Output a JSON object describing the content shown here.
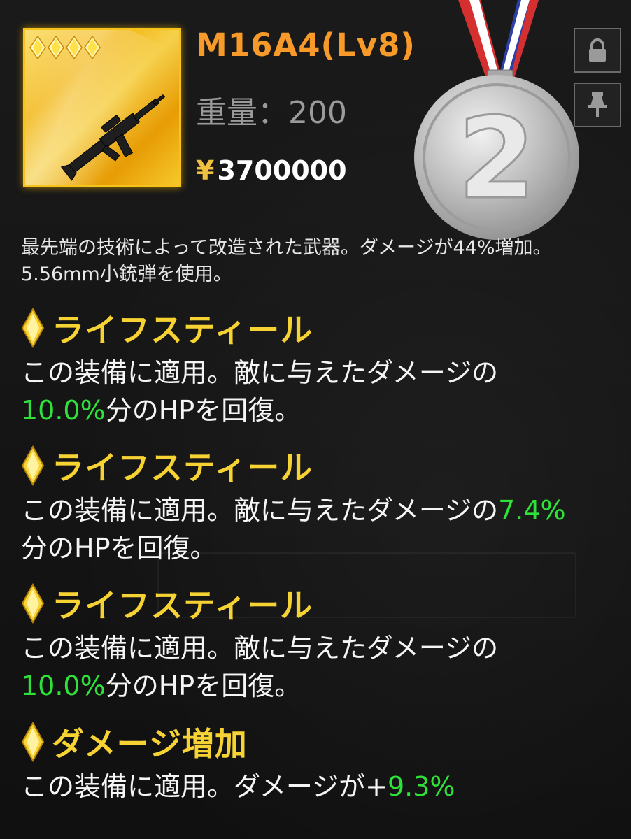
{
  "item": {
    "name": "M16A4(Lv8)",
    "weight": "重量：200",
    "price": "3700000",
    "price_symbol": "¥",
    "star_count": 4,
    "rarity_color": "#f7c21a",
    "icon": "assault-rifle-icon"
  },
  "rank_medal": {
    "number": "2",
    "type": "silver",
    "icon": "medal-2-icon"
  },
  "side_buttons": [
    {
      "icon": "lock-icon"
    },
    {
      "icon": "pin-icon"
    }
  ],
  "description": "最先端の技術によって改造された武器。ダメージが44%増加。5.56mm小銃弾を使用。",
  "effects": [
    {
      "title": "ライフスティール",
      "body_pre": "この装備に適用。敵に与えたダメージの",
      "value": "10.0%",
      "body_post": "分のHPを回復。"
    },
    {
      "title": "ライフスティール",
      "body_pre": "この装備に適用。敵に与えたダメージの",
      "value": "7.4%",
      "body_post": "分のHPを回復。"
    },
    {
      "title": "ライフスティール",
      "body_pre": "この装備に適用。敵に与えたダメージの",
      "value": "10.0%",
      "body_post": "分のHPを回復。"
    },
    {
      "title": "ダメージ増加",
      "body_pre": "この装備に適用。ダメージが+",
      "value": "9.3%",
      "body_post": ""
    }
  ],
  "colors": {
    "title": "#f79a2a",
    "effect_title": "#f7d233",
    "value_highlight": "#2fe23a",
    "background": "#121212"
  }
}
